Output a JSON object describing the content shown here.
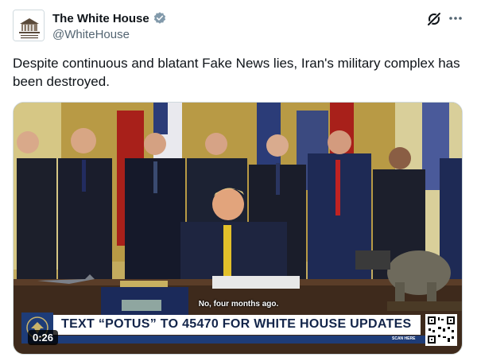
{
  "account": {
    "display_name": "The White House",
    "handle": "@WhiteHouse",
    "verified": true,
    "avatar_icon": "white-house-logo-icon"
  },
  "actions": {
    "grok_icon": "grok-icon",
    "more_icon": "more-options-icon"
  },
  "post": {
    "text": "Despite continuous and blatant Fake News lies, Iran's military complex has been destroyed."
  },
  "video": {
    "subtitle": "No, four months ago.",
    "banner_text": "TEXT “POTUS” TO 45470 FOR WHITE HOUSE UPDATES",
    "scan_label": "SCAN HERE",
    "duration": "0:26"
  },
  "colors": {
    "verified_badge": "#829aab",
    "banner_navy": "#1e3c78",
    "text_secondary": "#536471"
  }
}
